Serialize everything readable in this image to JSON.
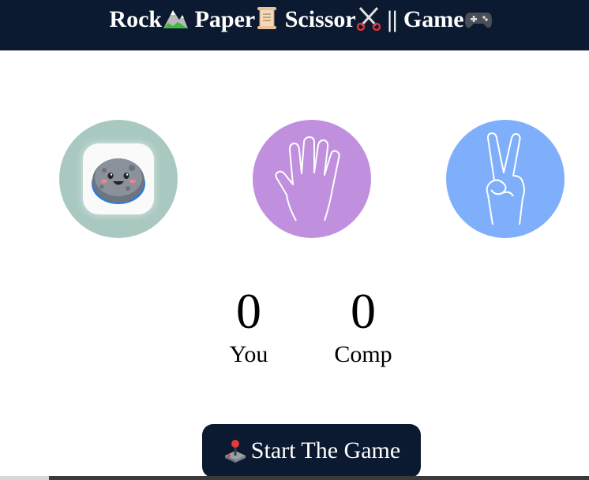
{
  "header": {
    "title_rock": "Rock",
    "title_paper": "Paper",
    "title_scissor": "Scissor",
    "title_game": "|| Game",
    "icons": [
      "mountain-icon",
      "scroll-icon",
      "scissors-icon",
      "gamepad-icon"
    ]
  },
  "choices": [
    {
      "name": "rock",
      "icon": "rock-face-icon",
      "color": "#a9c9c0"
    },
    {
      "name": "paper",
      "icon": "open-hand-icon",
      "color": "#c08fde"
    },
    {
      "name": "scissor",
      "icon": "victory-hand-icon",
      "color": "#7faefb"
    }
  ],
  "scores": {
    "you_value": "0",
    "you_label": "You",
    "comp_value": "0",
    "comp_label": "Comp"
  },
  "start_button": {
    "label": "Start The Game",
    "icon": "joystick-icon"
  },
  "colors": {
    "header_bg": "#0b1a30",
    "button_bg": "#0b1a30"
  }
}
